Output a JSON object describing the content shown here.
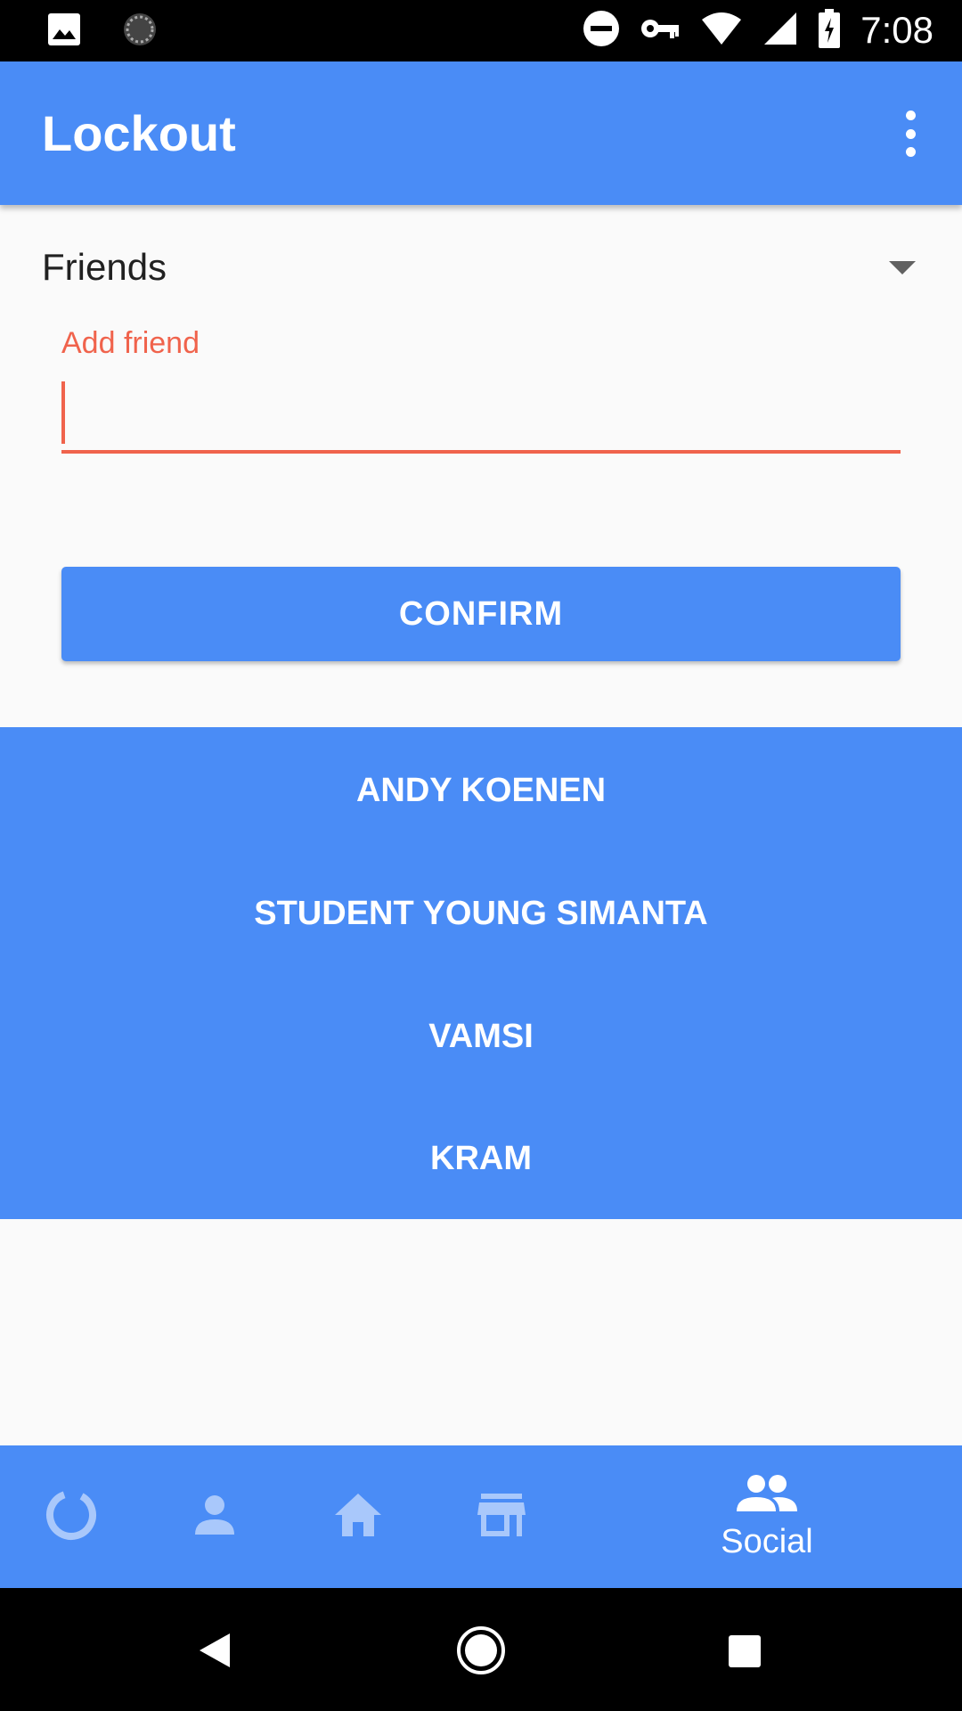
{
  "status_bar": {
    "time": "7:08",
    "icons": [
      "image-icon",
      "loading-icon",
      "do-not-disturb-icon",
      "vpn-key-icon",
      "wifi-icon",
      "signal-icon",
      "battery-charging-icon"
    ]
  },
  "app_bar": {
    "title": "Lockout",
    "menu_icon": "more-vert-icon"
  },
  "dropdown": {
    "selected": "Friends"
  },
  "add_friend": {
    "label": "Add friend",
    "value": ""
  },
  "confirm_button": {
    "label": "CONFIRM"
  },
  "friends": [
    "ANDY KOENEN",
    "STUDENT YOUNG SIMANTA",
    "VAMSI",
    "KRAM"
  ],
  "bottom_nav": {
    "items": [
      {
        "icon": "progress-ring-icon",
        "label": ""
      },
      {
        "icon": "person-icon",
        "label": ""
      },
      {
        "icon": "home-icon",
        "label": ""
      },
      {
        "icon": "store-icon",
        "label": ""
      },
      {
        "icon": "people-icon",
        "label": "Social"
      }
    ],
    "active_index": 4
  },
  "colors": {
    "primary": "#4a8cf6",
    "accent_error": "#f0634c",
    "inactive_icon": "#a9c8fb"
  }
}
